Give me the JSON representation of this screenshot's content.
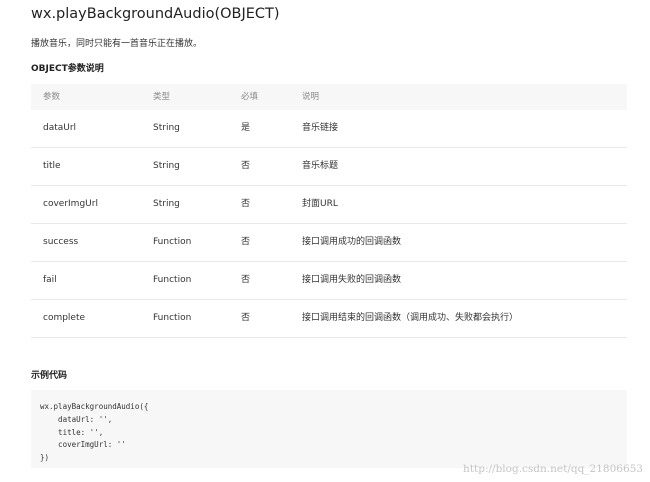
{
  "page": {
    "title": "wx.playBackgroundAudio(OBJECT)",
    "description": "播放音乐，同时只能有一首音乐正在播放。",
    "params_heading": "OBJECT参数说明",
    "example_heading": "示例代码"
  },
  "table": {
    "headers": [
      "参数",
      "类型",
      "必填",
      "说明"
    ],
    "rows": [
      [
        "dataUrl",
        "String",
        "是",
        "音乐链接"
      ],
      [
        "title",
        "String",
        "否",
        "音乐标题"
      ],
      [
        "coverImgUrl",
        "String",
        "否",
        "封面URL"
      ],
      [
        "success",
        "Function",
        "否",
        "接口调用成功的回调函数"
      ],
      [
        "fail",
        "Function",
        "否",
        "接口调用失败的回调函数"
      ],
      [
        "complete",
        "Function",
        "否",
        "接口调用结束的回调函数（调用成功、失败都会执行）"
      ]
    ]
  },
  "code": {
    "lines": [
      "wx.playBackgroundAudio({",
      "    dataUrl: '',",
      "    title: '',",
      "    coverImgUrl: ''",
      "})"
    ]
  },
  "watermark": "http://blog.csdn.net/qq_21806653"
}
